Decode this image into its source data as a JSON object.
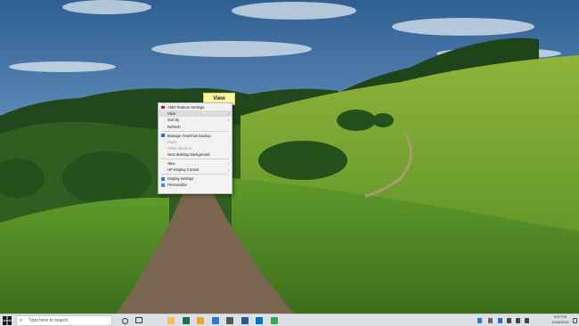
{
  "callout": {
    "label": "View"
  },
  "context_menu": {
    "items": [
      {
        "label": "AMD Radeon Settings",
        "icon": "amd-radeon-icon",
        "icon_color": "#c8102e",
        "disabled": false,
        "submenu": false
      },
      {
        "label": "View",
        "icon": "",
        "disabled": false,
        "submenu": true,
        "highlighted": true
      },
      {
        "label": "Sort by",
        "icon": "",
        "disabled": false,
        "submenu": true
      },
      {
        "label": "Refresh",
        "icon": "",
        "disabled": false,
        "submenu": false
      },
      {
        "separator": true
      },
      {
        "label": "Manage OneDrive backup",
        "icon": "onedrive-icon",
        "icon_color": "#1f6fd0",
        "disabled": false,
        "submenu": false
      },
      {
        "label": "Paste",
        "icon": "",
        "disabled": true,
        "submenu": false
      },
      {
        "label": "Paste shortcut",
        "icon": "",
        "disabled": true,
        "submenu": false
      },
      {
        "label": "Next desktop background",
        "icon": "",
        "disabled": false,
        "submenu": false
      },
      {
        "separator": true
      },
      {
        "label": "New",
        "icon": "",
        "disabled": false,
        "submenu": true
      },
      {
        "label": "HP Display Control",
        "icon": "",
        "disabled": false,
        "submenu": true
      },
      {
        "separator": true
      },
      {
        "label": "Display settings",
        "icon": "display-icon",
        "icon_color": "#2a7bd5",
        "disabled": false,
        "submenu": false
      },
      {
        "label": "Personalize",
        "icon": "personalize-icon",
        "icon_color": "#3a8ee6",
        "disabled": false,
        "submenu": false
      }
    ]
  },
  "taskbar": {
    "search_placeholder": "Type here to search",
    "pinned": [
      {
        "name": "file-explorer-icon",
        "color": "#f2c14e"
      },
      {
        "name": "excel-icon",
        "color": "#1e7145"
      },
      {
        "name": "folder-icon",
        "color": "#e8a72a"
      },
      {
        "name": "mail-icon",
        "color": "#2b78d0"
      },
      {
        "name": "photos-icon",
        "color": "#555555"
      },
      {
        "name": "word-icon",
        "color": "#2b5797"
      },
      {
        "name": "outlook-icon",
        "color": "#0072c6"
      },
      {
        "name": "chrome-icon",
        "color": "#34a853"
      }
    ],
    "clock_time": "3:57 PM",
    "clock_date": "10/16/2019"
  }
}
